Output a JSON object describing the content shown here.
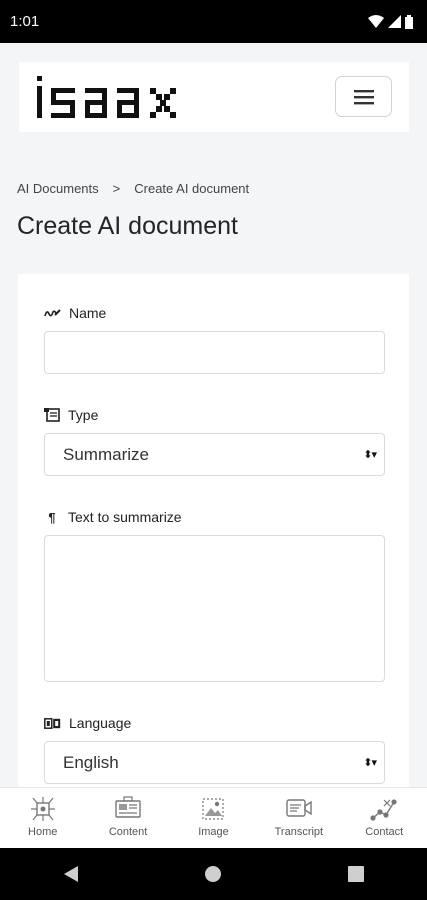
{
  "status_bar": {
    "time": "1:01",
    "icons": [
      "wifi-icon",
      "signal-icon",
      "battery-icon"
    ]
  },
  "header": {
    "logo_text": "isaax",
    "menu_icon": "hamburger-icon"
  },
  "breadcrumb": {
    "items": [
      "AI Documents",
      "Create AI document"
    ],
    "separator": ">"
  },
  "page_title": "Create AI document",
  "form": {
    "name": {
      "label": "Name",
      "icon": "pencil-scribble-icon",
      "value": "",
      "placeholder": ""
    },
    "type": {
      "label": "Type",
      "icon": "document-icon",
      "selected": "Summarize"
    },
    "text": {
      "label": "Text to summarize",
      "icon": "paragraph-icon",
      "value": ""
    },
    "language": {
      "label": "Language",
      "icon": "translate-icon",
      "selected": "English"
    }
  },
  "bottom_nav": [
    {
      "label": "Home",
      "icon": "home-circuit-icon"
    },
    {
      "label": "Content",
      "icon": "content-icon"
    },
    {
      "label": "Image",
      "icon": "image-icon"
    },
    {
      "label": "Transcript",
      "icon": "transcript-icon"
    },
    {
      "label": "Contact",
      "icon": "contact-icon"
    }
  ],
  "system_nav": [
    "back-icon",
    "home-icon",
    "recents-icon"
  ],
  "colors": {
    "status_bar": "#000000",
    "page_bg": "#f4f5f7",
    "card_bg": "#ffffff",
    "border": "#d8dbdf"
  }
}
